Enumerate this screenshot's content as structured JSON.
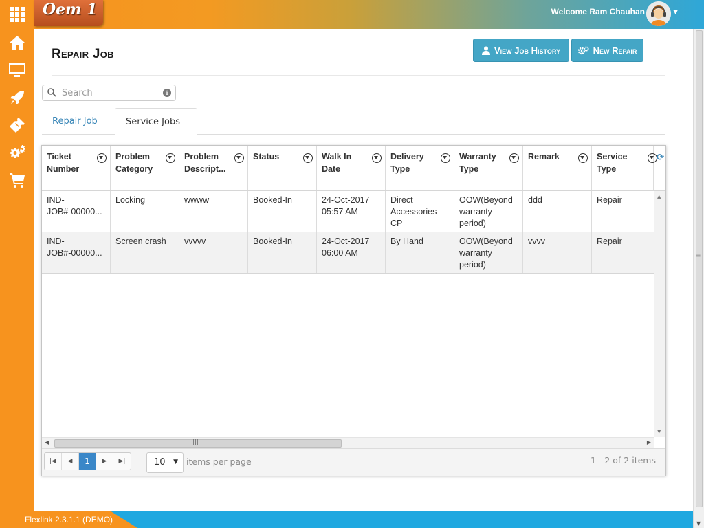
{
  "header": {
    "logo": "Oem 1",
    "welcome": "Welcome Ram Chauhan"
  },
  "sidebar": {
    "items": [
      {
        "icon": "home-icon"
      },
      {
        "icon": "monitor-icon"
      },
      {
        "icon": "rocket-icon"
      },
      {
        "icon": "ticket-icon"
      },
      {
        "icon": "gears-icon"
      },
      {
        "icon": "cart-icon"
      }
    ]
  },
  "page": {
    "title": "Repair Job",
    "btn_history": "View Job History",
    "btn_new": "New Repair"
  },
  "search": {
    "placeholder": "Search"
  },
  "tabs": {
    "repair": "Repair Job",
    "service": "Service Jobs"
  },
  "columns": [
    "Ticket Number",
    "Problem Category",
    "Problem Descript...",
    "Status",
    "Walk In Date",
    "Delivery Type",
    "Warranty Type",
    "Remark",
    "Service Type"
  ],
  "rows": [
    {
      "ticket": "IND-JOB#-00000...",
      "category": "Locking",
      "description": "wwww",
      "status": "Booked-In",
      "walkin": "24-Oct-2017 05:57 AM",
      "delivery": "Direct Accessories-CP",
      "warranty": "OOW(Beyond warranty period)",
      "remark": "ddd",
      "service": "Repair"
    },
    {
      "ticket": "IND-JOB#-00000...",
      "category": "Screen crash",
      "description": "vvvvv",
      "status": "Booked-In",
      "walkin": "24-Oct-2017 06:00 AM",
      "delivery": "By Hand",
      "warranty": "OOW(Beyond warranty period)",
      "remark": "vvvv",
      "service": "Repair"
    }
  ],
  "pager": {
    "current_page": "1",
    "page_size": "10",
    "per_page_label": "items per page",
    "info": "1 - 2 of 2 items"
  },
  "footer": {
    "version": "Flexlink 2.3.1.1 (DEMO)"
  },
  "colors": {
    "sidebar": "#f7931e",
    "accent_button": "#44a6c6",
    "footer": "#1fa8e0",
    "active_page": "#3a87c8"
  }
}
